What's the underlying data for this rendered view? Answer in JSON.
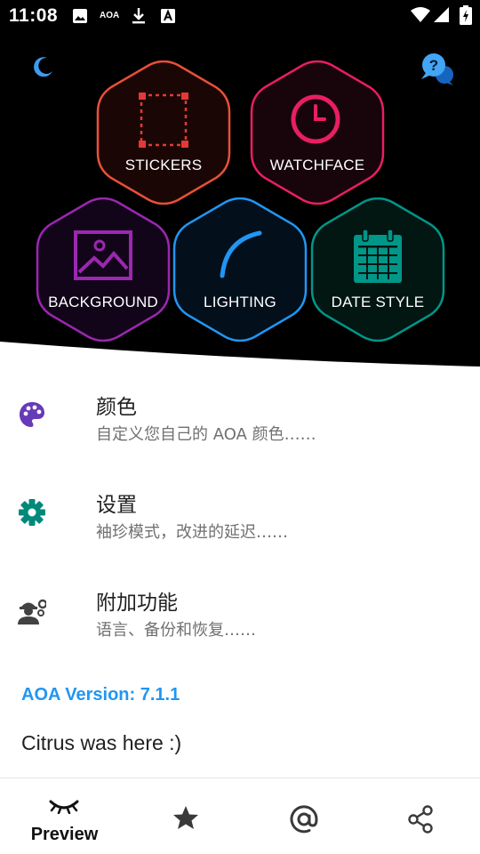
{
  "status_bar": {
    "time": "11:08",
    "aoa_label": "AOA",
    "left_icons": [
      "image-icon",
      "aoa-text-icon",
      "download-icon",
      "a-box-icon"
    ],
    "right_icons": [
      "wifi-icon",
      "signal-icon",
      "battery-charging-icon"
    ]
  },
  "header": {
    "left_icon": "moon-icon",
    "right_icon": "help-chat-icon"
  },
  "hex_menu": [
    {
      "label": "STICKERS",
      "icon": "sticker-frame-icon",
      "color": "#E8503A"
    },
    {
      "label": "WATCHFACE",
      "icon": "clock-icon",
      "color": "#E91E63"
    },
    {
      "label": "BACKGROUND",
      "icon": "image-icon",
      "color": "#9C27B0"
    },
    {
      "label": "LIGHTING",
      "icon": "arc-icon",
      "color": "#2196F3"
    },
    {
      "label": "DATE STYLE",
      "icon": "calendar-icon",
      "color": "#009688"
    }
  ],
  "menu": [
    {
      "title": "颜色",
      "subtitle": "自定义您自己的 AOA 颜色……",
      "icon": "palette-icon",
      "icon_color": "#673AB7"
    },
    {
      "title": "设置",
      "subtitle": "袖珍模式，改进的延迟……",
      "icon": "gear-icon",
      "icon_color": "#00897B"
    },
    {
      "title": "附加功能",
      "subtitle": "语言、备份和恢复……",
      "icon": "worker-settings-icon",
      "icon_color": "#424242"
    }
  ],
  "version": "AOA Version: 7.1.1",
  "note": "Citrus was here :)",
  "bottom_nav": [
    {
      "label": "Preview",
      "icon": "closed-eye-icon"
    },
    {
      "label": "",
      "icon": "star-icon"
    },
    {
      "label": "",
      "icon": "at-sign-icon"
    },
    {
      "label": "",
      "icon": "share-icon"
    }
  ],
  "colors": {
    "accent": "#2196F3",
    "hero_bg": "#000000"
  }
}
